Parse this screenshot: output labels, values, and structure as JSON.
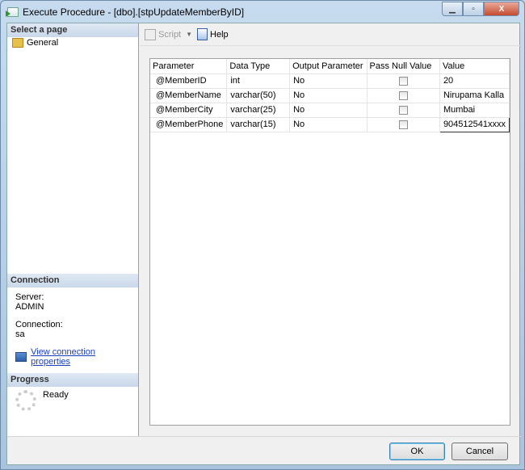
{
  "window": {
    "title": "Execute Procedure - [dbo].[stpUpdateMemberByID]",
    "close": "X"
  },
  "sidebar": {
    "select_page": "Select a page",
    "pages": [
      "General"
    ],
    "connection": {
      "heading": "Connection",
      "server_label": "Server:",
      "server": "ADMIN",
      "connection_label": "Connection:",
      "connection": "sa",
      "link": "View connection properties"
    },
    "progress": {
      "heading": "Progress",
      "status": "Ready"
    }
  },
  "toolbar": {
    "script": "Script",
    "help": "Help"
  },
  "grid": {
    "columns": [
      "Parameter",
      "Data Type",
      "Output Parameter",
      "Pass Null Value",
      "Value"
    ],
    "rows": [
      {
        "parameter": "@MemberID",
        "type": "int",
        "output": "No",
        "pass_null": false,
        "value": "20"
      },
      {
        "parameter": "@MemberName",
        "type": "varchar(50)",
        "output": "No",
        "pass_null": false,
        "value": "Nirupama Kalla"
      },
      {
        "parameter": "@MemberCity",
        "type": "varchar(25)",
        "output": "No",
        "pass_null": false,
        "value": "Mumbai"
      },
      {
        "parameter": "@MemberPhone",
        "type": "varchar(15)",
        "output": "No",
        "pass_null": false,
        "value": "904512541xxxx"
      }
    ]
  },
  "buttons": {
    "ok": "OK",
    "cancel": "Cancel"
  }
}
